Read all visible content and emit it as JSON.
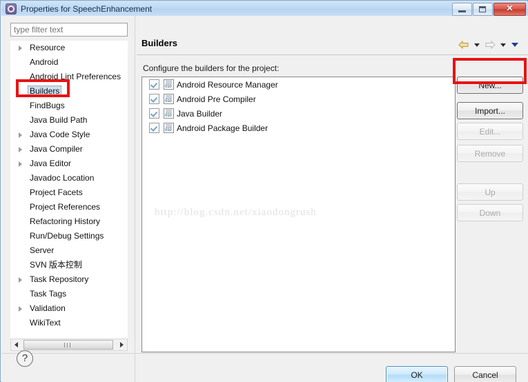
{
  "window": {
    "title": "Properties for SpeechEnhancement",
    "icon": "properties-gear-icon",
    "minimize_label": "",
    "maximize_label": "",
    "close_label": "✕"
  },
  "sidebar": {
    "filter": {
      "value": "",
      "placeholder": "type filter text"
    },
    "items": [
      {
        "label": "Resource",
        "expandable": true,
        "selected": false
      },
      {
        "label": "Android",
        "expandable": false,
        "selected": false
      },
      {
        "label": "Android Lint Preferences",
        "expandable": false,
        "selected": false
      },
      {
        "label": "Builders",
        "expandable": false,
        "selected": true
      },
      {
        "label": "FindBugs",
        "expandable": false,
        "selected": false
      },
      {
        "label": "Java Build Path",
        "expandable": false,
        "selected": false
      },
      {
        "label": "Java Code Style",
        "expandable": true,
        "selected": false
      },
      {
        "label": "Java Compiler",
        "expandable": true,
        "selected": false
      },
      {
        "label": "Java Editor",
        "expandable": true,
        "selected": false
      },
      {
        "label": "Javadoc Location",
        "expandable": false,
        "selected": false
      },
      {
        "label": "Project Facets",
        "expandable": false,
        "selected": false
      },
      {
        "label": "Project References",
        "expandable": false,
        "selected": false
      },
      {
        "label": "Refactoring History",
        "expandable": false,
        "selected": false
      },
      {
        "label": "Run/Debug Settings",
        "expandable": false,
        "selected": false
      },
      {
        "label": "Server",
        "expandable": false,
        "selected": false
      },
      {
        "label": "SVN 版本控制",
        "expandable": false,
        "selected": false
      },
      {
        "label": "Task Repository",
        "expandable": true,
        "selected": false
      },
      {
        "label": "Task Tags",
        "expandable": false,
        "selected": false
      },
      {
        "label": "Validation",
        "expandable": true,
        "selected": false
      },
      {
        "label": "WikiText",
        "expandable": false,
        "selected": false
      }
    ]
  },
  "page": {
    "title": "Builders",
    "description": "Configure the builders for the project:",
    "watermark": "http://blog.csdn.net/xiaodongrush",
    "nav": {
      "back_icon": "back-arrow-icon",
      "back_menu_icon": "chevron-down-icon",
      "forward_icon": "forward-arrow-icon",
      "forward_menu_icon": "chevron-down-icon",
      "view_menu_icon": "chevron-down-icon"
    },
    "builders": [
      {
        "label": "Android Resource Manager",
        "checked": true,
        "icon": "builder-file-icon"
      },
      {
        "label": "Android Pre Compiler",
        "checked": true,
        "icon": "builder-file-icon"
      },
      {
        "label": "Java Builder",
        "checked": true,
        "icon": "builder-file-icon"
      },
      {
        "label": "Android Package Builder",
        "checked": true,
        "icon": "builder-file-icon"
      }
    ],
    "side_buttons": [
      {
        "label": "New...",
        "enabled": true,
        "highlighted": true
      },
      {
        "label": "Import...",
        "enabled": true,
        "highlighted": false
      },
      {
        "label": "Edit...",
        "enabled": false,
        "highlighted": false
      },
      {
        "label": "Remove",
        "enabled": false,
        "highlighted": false
      },
      {
        "label": "Up",
        "enabled": false,
        "highlighted": false
      },
      {
        "label": "Down",
        "enabled": false,
        "highlighted": false
      }
    ]
  },
  "footer": {
    "help_icon": "?",
    "ok_label": "OK",
    "cancel_label": "Cancel"
  },
  "annotations": {
    "color": "#e81313",
    "targets": [
      "Builders",
      "New..."
    ]
  }
}
